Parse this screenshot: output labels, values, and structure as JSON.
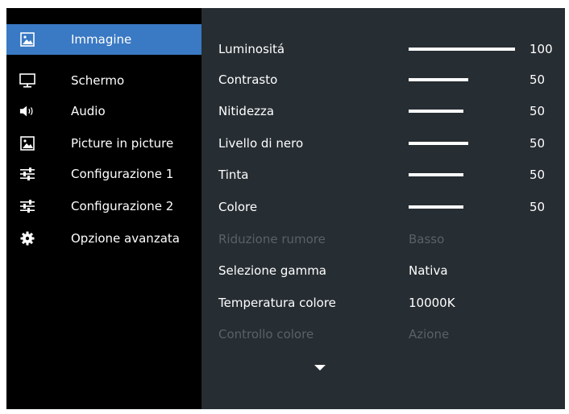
{
  "sidebar": {
    "items": [
      {
        "label": "Immagine",
        "icon": "picture-icon",
        "active": true
      },
      {
        "label": "Schermo",
        "icon": "monitor-icon"
      },
      {
        "label": "Audio",
        "icon": "speaker-icon"
      },
      {
        "label": "Picture in picture",
        "icon": "picture-icon"
      },
      {
        "label": "Configurazione 1",
        "icon": "sliders-icon"
      },
      {
        "label": "Configurazione 2",
        "icon": "sliders-icon"
      },
      {
        "label": "Opzione avanzata",
        "icon": "gear-icon"
      }
    ]
  },
  "settings": {
    "luminosita": {
      "label": "Luminositá",
      "value": "100",
      "level": 100
    },
    "contrasto": {
      "label": "Contrasto",
      "value": "50",
      "level": 50
    },
    "nitidezza": {
      "label": "Nitidezza",
      "value": "50",
      "level": 50
    },
    "livello_nero": {
      "label": "Livello di nero",
      "value": "50",
      "level": 50
    },
    "tinta": {
      "label": "Tinta",
      "value": "50",
      "level": 50
    },
    "colore": {
      "label": "Colore",
      "value": "50",
      "level": 50
    },
    "riduzione_rumore": {
      "label": "Riduzione rumore",
      "value": "Basso",
      "enabled": false
    },
    "selezione_gamma": {
      "label": "Selezione gamma",
      "value": "Nativa"
    },
    "temperatura_colore": {
      "label": "Temperatura colore",
      "value": "10000K"
    },
    "controllo_colore": {
      "label": "Controllo colore",
      "value": "Azione",
      "enabled": false
    }
  },
  "colors": {
    "active": "#3a79c3",
    "panel": "#262d33",
    "sidebar": "#000000",
    "disabled": "#5a6167"
  }
}
